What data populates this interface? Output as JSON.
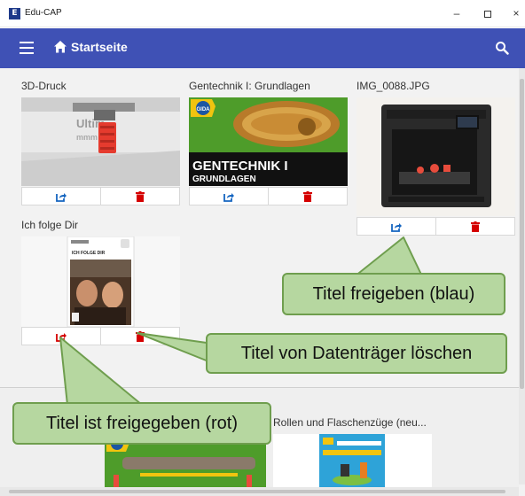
{
  "window": {
    "title": "Edu-CAP",
    "minimize": "–",
    "close": "×"
  },
  "appbar": {
    "title": "Startseite"
  },
  "colors": {
    "primary": "#3f51b5",
    "share_blue": "#1565c0",
    "share_red": "#d50000",
    "delete_red": "#d50000",
    "callout_bg": "#b6d7a0"
  },
  "icons": {
    "menu": "hamburger-menu-icon",
    "home": "home-icon",
    "search": "search-icon",
    "share": "share-icon",
    "delete": "trash-icon"
  },
  "tiles": [
    {
      "title": "3D-Druck",
      "shared": false
    },
    {
      "title": "Gentechnik I: Grundlagen",
      "shared": false,
      "poster": {
        "line1": "GENTECHNIK I",
        "line2": "GRUNDLAGEN",
        "logo": "GIDA"
      }
    },
    {
      "title": "IMG_0088.JPG",
      "shared": false
    },
    {
      "title": "Ich folge Dir",
      "shared": true,
      "poster": {
        "heading": "ICH FOLGE DIR"
      }
    }
  ],
  "tiles_bottom": [
    {
      "title": "Rollen und Flaschenzüge (neu..."
    }
  ],
  "callouts": {
    "share_blue": "Titel freigeben (blau)",
    "delete": "Titel von Datenträger löschen",
    "share_red": "Titel ist freigegeben (rot)"
  }
}
